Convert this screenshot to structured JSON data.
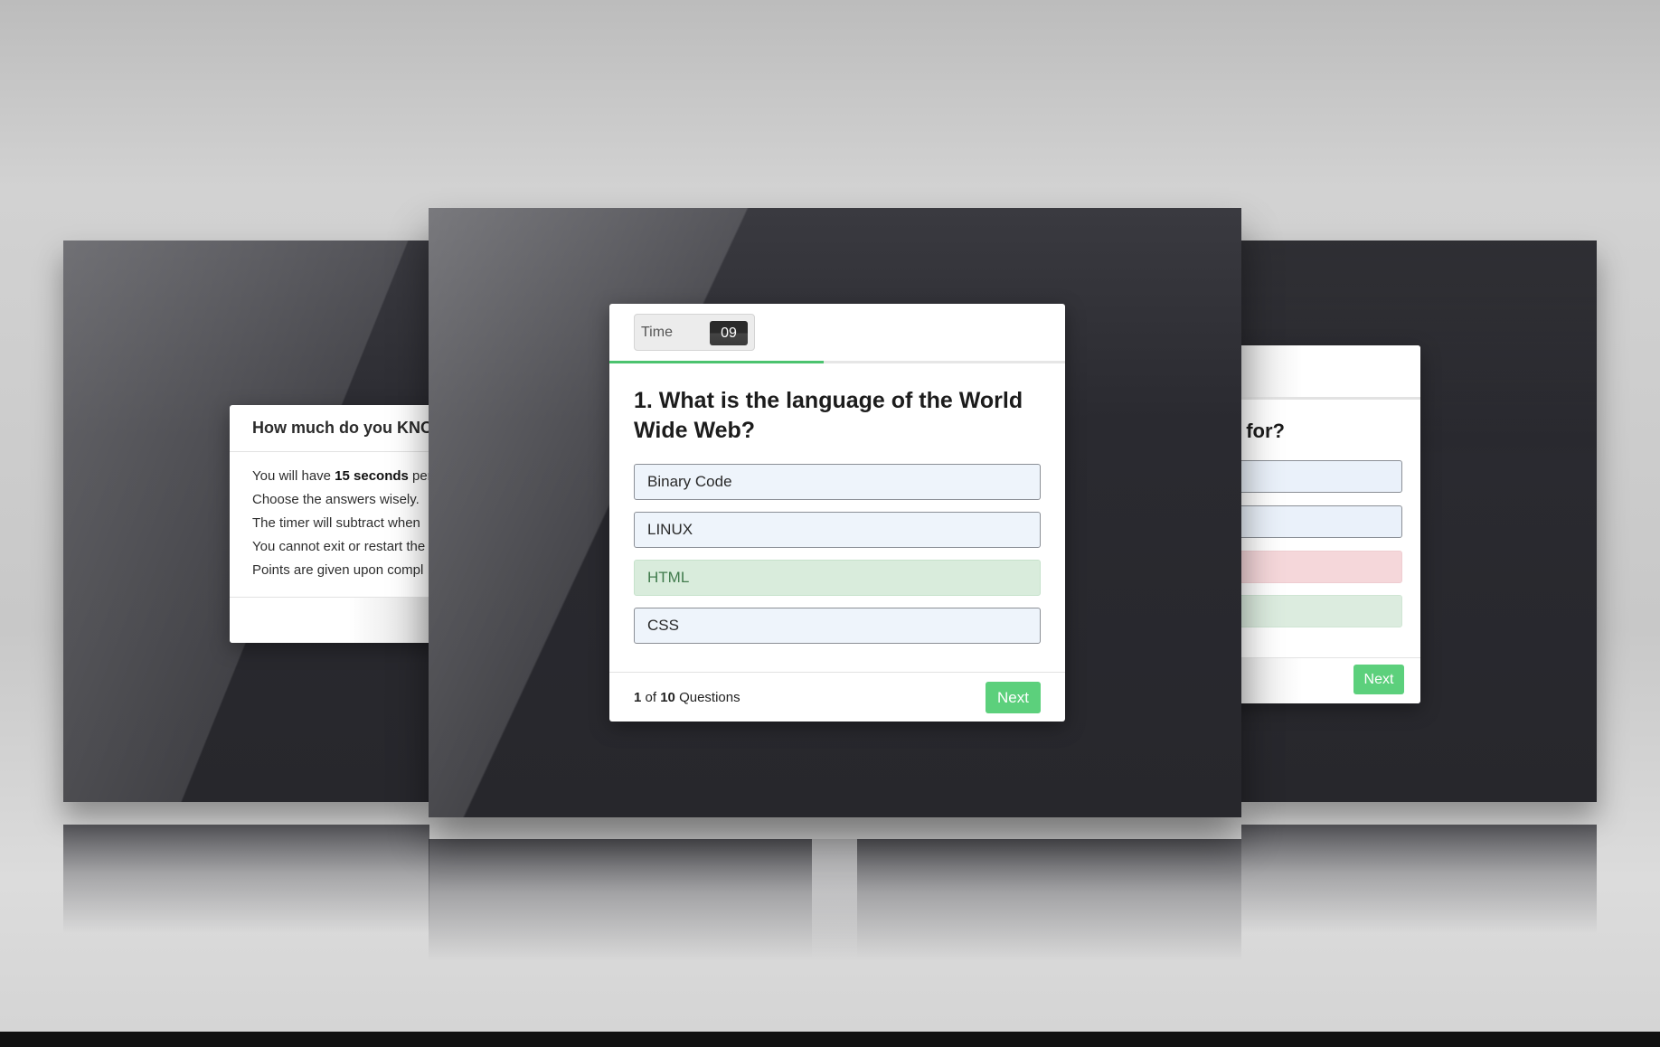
{
  "intro": {
    "title": "How much do you KNO",
    "rules": [
      {
        "before": "You will have ",
        "bold": "15 seconds",
        "after": " per"
      },
      {
        "before": "Choose the answers wisely.",
        "bold": "",
        "after": ""
      },
      {
        "before": "The timer will subtract when",
        "bold": "",
        "after": ""
      },
      {
        "before": "You cannot exit or restart the",
        "bold": "",
        "after": ""
      },
      {
        "before": "Points are given upon compl",
        "bold": "",
        "after": ""
      }
    ]
  },
  "quiz": {
    "timer_label": "Time",
    "timer_value": "09",
    "question": "1. What is the language of the World Wide Web?",
    "options": [
      {
        "label": "Binary Code",
        "state": "default"
      },
      {
        "label": "LINUX",
        "state": "default"
      },
      {
        "label": "HTML",
        "state": "correct"
      },
      {
        "label": "CSS",
        "state": "default"
      }
    ],
    "counter": {
      "current": "1",
      "of": "of",
      "total": "10",
      "suffix": "Questions"
    },
    "next_label": "Next"
  },
  "side": {
    "question_fragment": "and for?",
    "next_label": "Next"
  },
  "colors": {
    "accent_green": "#5cd07c",
    "correct_bg": "#d9ecdc",
    "wrong_bg": "#f5d7da",
    "option_bg": "#eef4fb",
    "screen_bg": "#2a2a30"
  }
}
